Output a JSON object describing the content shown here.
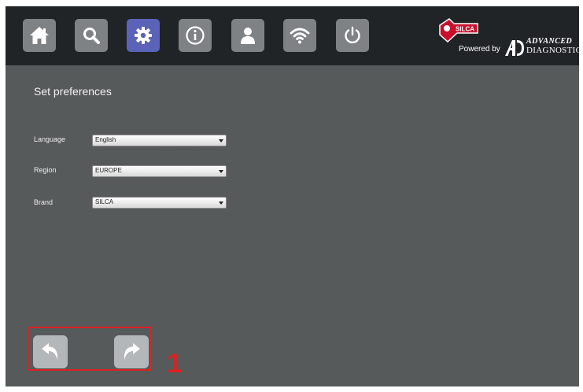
{
  "nav": [
    {
      "name": "home-icon",
      "active": false
    },
    {
      "name": "search-icon",
      "active": false
    },
    {
      "name": "gear-icon",
      "active": true
    },
    {
      "name": "info-icon",
      "active": false
    },
    {
      "name": "user-icon",
      "active": false
    },
    {
      "name": "wifi-icon",
      "active": false
    },
    {
      "name": "power-icon",
      "active": false
    }
  ],
  "brand": {
    "logo_text": "SILCA",
    "powered_by": "Powered by",
    "partner_top": "ADVANCED",
    "partner_bottom": "DIAGNOSTICS"
  },
  "page": {
    "title": "Set preferences"
  },
  "form": {
    "language_label": "Language",
    "language_value": "English",
    "region_label": "Region",
    "region_value": "EUROPE",
    "brand_label": "Brand",
    "brand_value": "SILCA"
  },
  "footer": {
    "back_icon": "back-arrow-icon",
    "forward_icon": "forward-arrow-icon",
    "callout_number": "1"
  },
  "colors": {
    "topbar": "#202426",
    "background": "#565a5b",
    "nav_button": "#7e8285",
    "nav_active": "#5a63b8",
    "callout": "#e02020"
  }
}
